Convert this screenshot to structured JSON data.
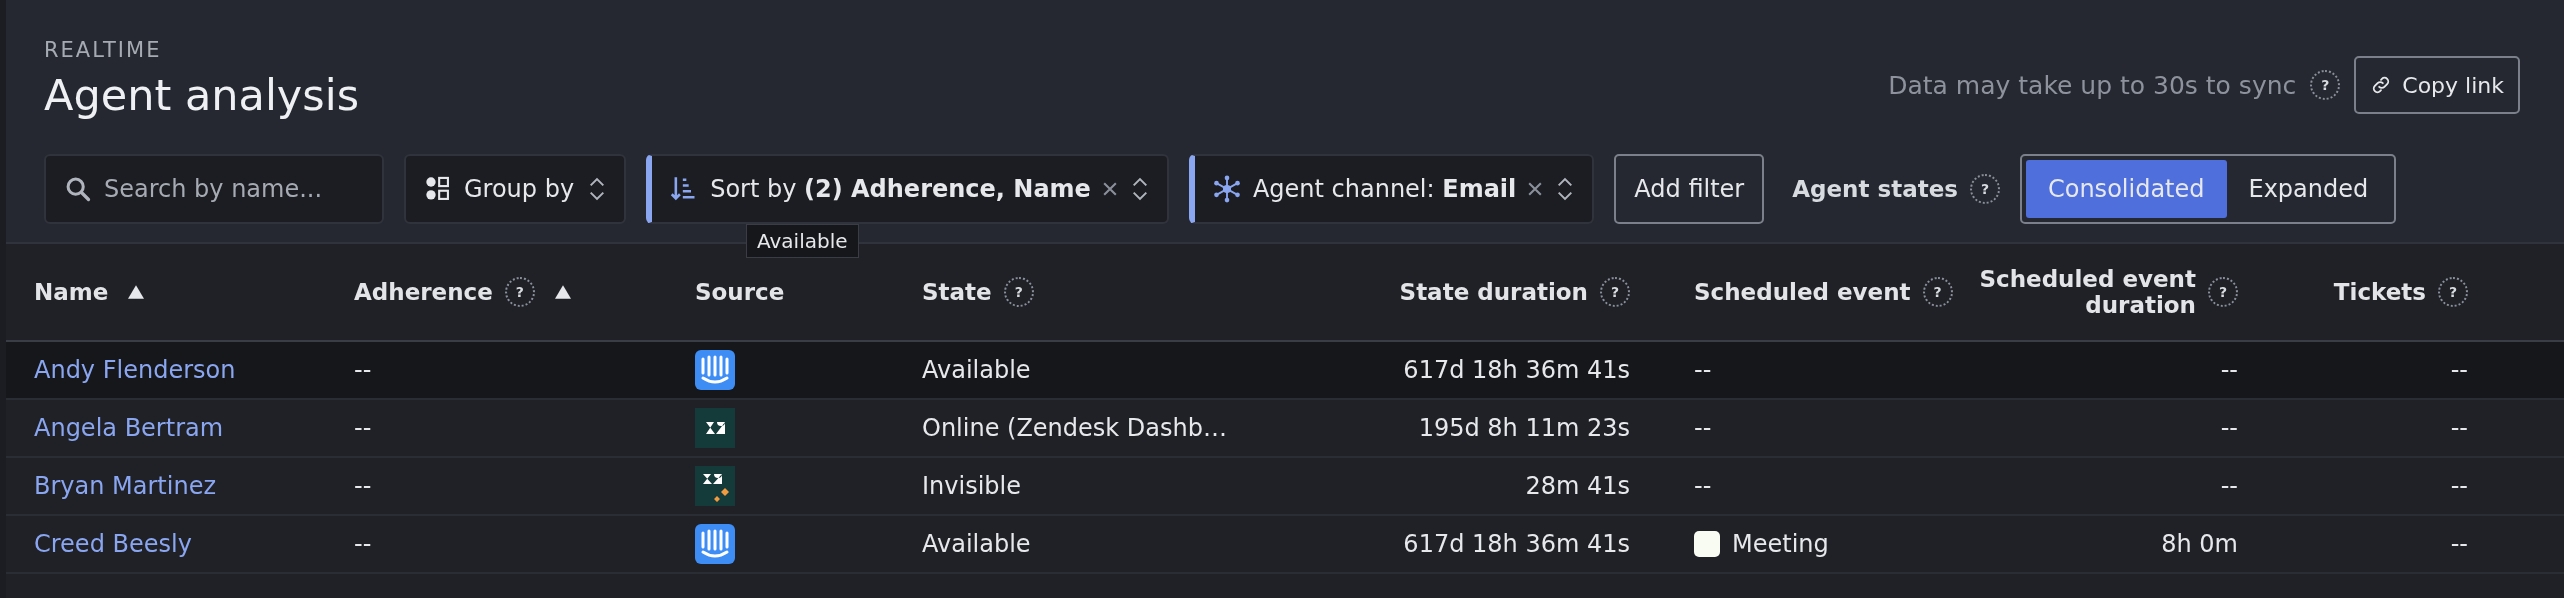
{
  "header": {
    "eyebrow": "REALTIME",
    "title": "Agent analysis",
    "sync_note": "Data may take up to 30s to sync",
    "sync_help": "?",
    "copy_button": "Copy link"
  },
  "toolbar": {
    "search": {
      "placeholder": "Search by name..."
    },
    "group_by": "Group by",
    "sort": {
      "label": "Sort by",
      "value": "(2) Adherence, Name"
    },
    "channel_filter": {
      "label": "Agent channel:",
      "value": "Email"
    },
    "add_filter": "Add filter",
    "agent_states": {
      "label": "Agent states",
      "help": "?",
      "options": [
        {
          "label": "Consolidated",
          "selected": true
        },
        {
          "label": "Expanded",
          "selected": false
        }
      ]
    }
  },
  "tooltip": "Available",
  "table": {
    "columns": [
      {
        "label": "Name",
        "sorted": true
      },
      {
        "label": "Adherence",
        "help": "?",
        "sorted": true
      },
      {
        "label": "Source",
        "sorted": false
      },
      {
        "label": "State",
        "help": "?",
        "sorted": false
      },
      {
        "label": "State duration",
        "help": "?",
        "sorted": false
      },
      {
        "label": "Scheduled event",
        "help": "?",
        "sorted": false
      },
      {
        "label": "Scheduled event duration",
        "help": "?",
        "sorted": false
      },
      {
        "label": "Tickets",
        "help": "?",
        "sorted": false
      }
    ],
    "rows": [
      {
        "name": "Andy Flenderson",
        "adherence": "--",
        "source": {
          "kind": "intercom"
        },
        "state": "Available",
        "state_duration": "617d 18h 36m 41s",
        "event": {
          "label": "--"
        },
        "event_duration": "--",
        "tickets": "--",
        "highlighted": true
      },
      {
        "name": "Angela Bertram",
        "adherence": "--",
        "source": {
          "kind": "zendesk"
        },
        "state": "Online (Zendesk Dashb…",
        "state_duration": "195d 8h 11m 23s",
        "event": {
          "label": "--"
        },
        "event_duration": "--",
        "tickets": "--",
        "highlighted": false
      },
      {
        "name": "Bryan Martinez",
        "adherence": "--",
        "source": {
          "kind": "zendesk_talk"
        },
        "state": "Invisible",
        "state_duration": "28m 41s",
        "event": {
          "label": "--"
        },
        "event_duration": "--",
        "tickets": "--",
        "highlighted": false
      },
      {
        "name": "Creed Beesly",
        "adherence": "--",
        "source": {
          "kind": "intercom"
        },
        "state": "Available",
        "state_duration": "617d 18h 36m 41s",
        "event": {
          "label": "Meeting",
          "color": "#f8fcf3"
        },
        "event_duration": "8h 0m",
        "tickets": "--",
        "highlighted": false
      }
    ]
  }
}
